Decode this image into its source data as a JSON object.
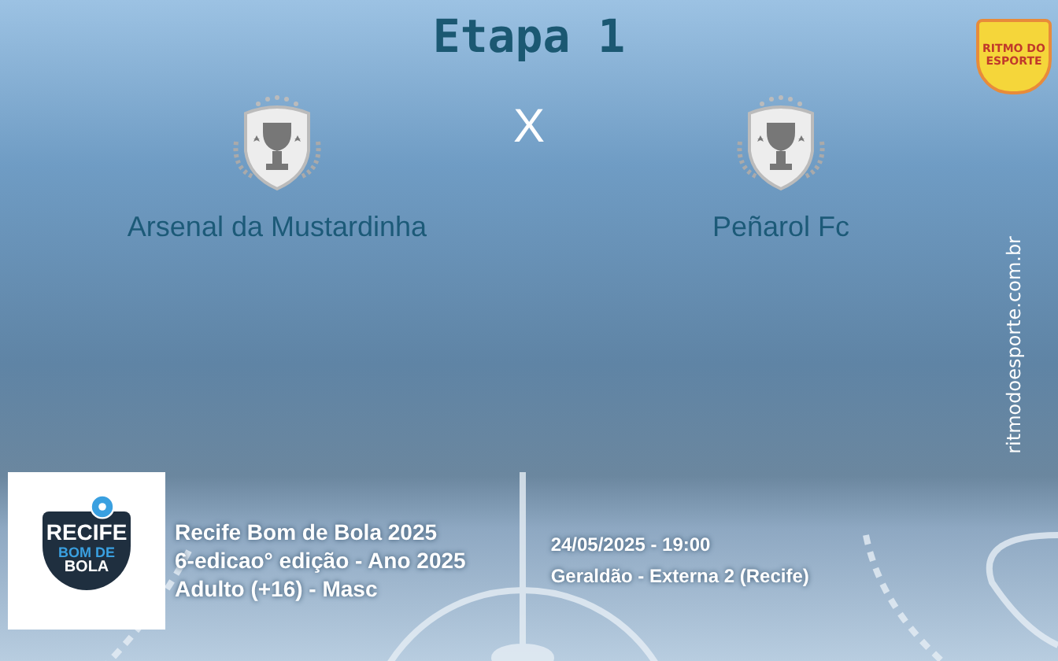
{
  "title": "Etapa 1",
  "brand": {
    "logo_text": "RITMO DO ESPORTE",
    "site": "ritmodoesporte.com.br"
  },
  "match": {
    "home": {
      "name": "Arsenal da Mustardinha"
    },
    "separator": "X",
    "away": {
      "name": "Peñarol Fc"
    }
  },
  "tournament": {
    "logo_lines": [
      "RECIFE",
      "BOM DE",
      "BOLA"
    ],
    "lines": [
      "Recife Bom de Bola 2025",
      "6-edicao° edição - Ano 2025",
      "Adulto (+16) - Masc"
    ],
    "datetime": "24/05/2025 - 19:00",
    "venue": "Geraldão - Externa 2 (Recife)"
  }
}
